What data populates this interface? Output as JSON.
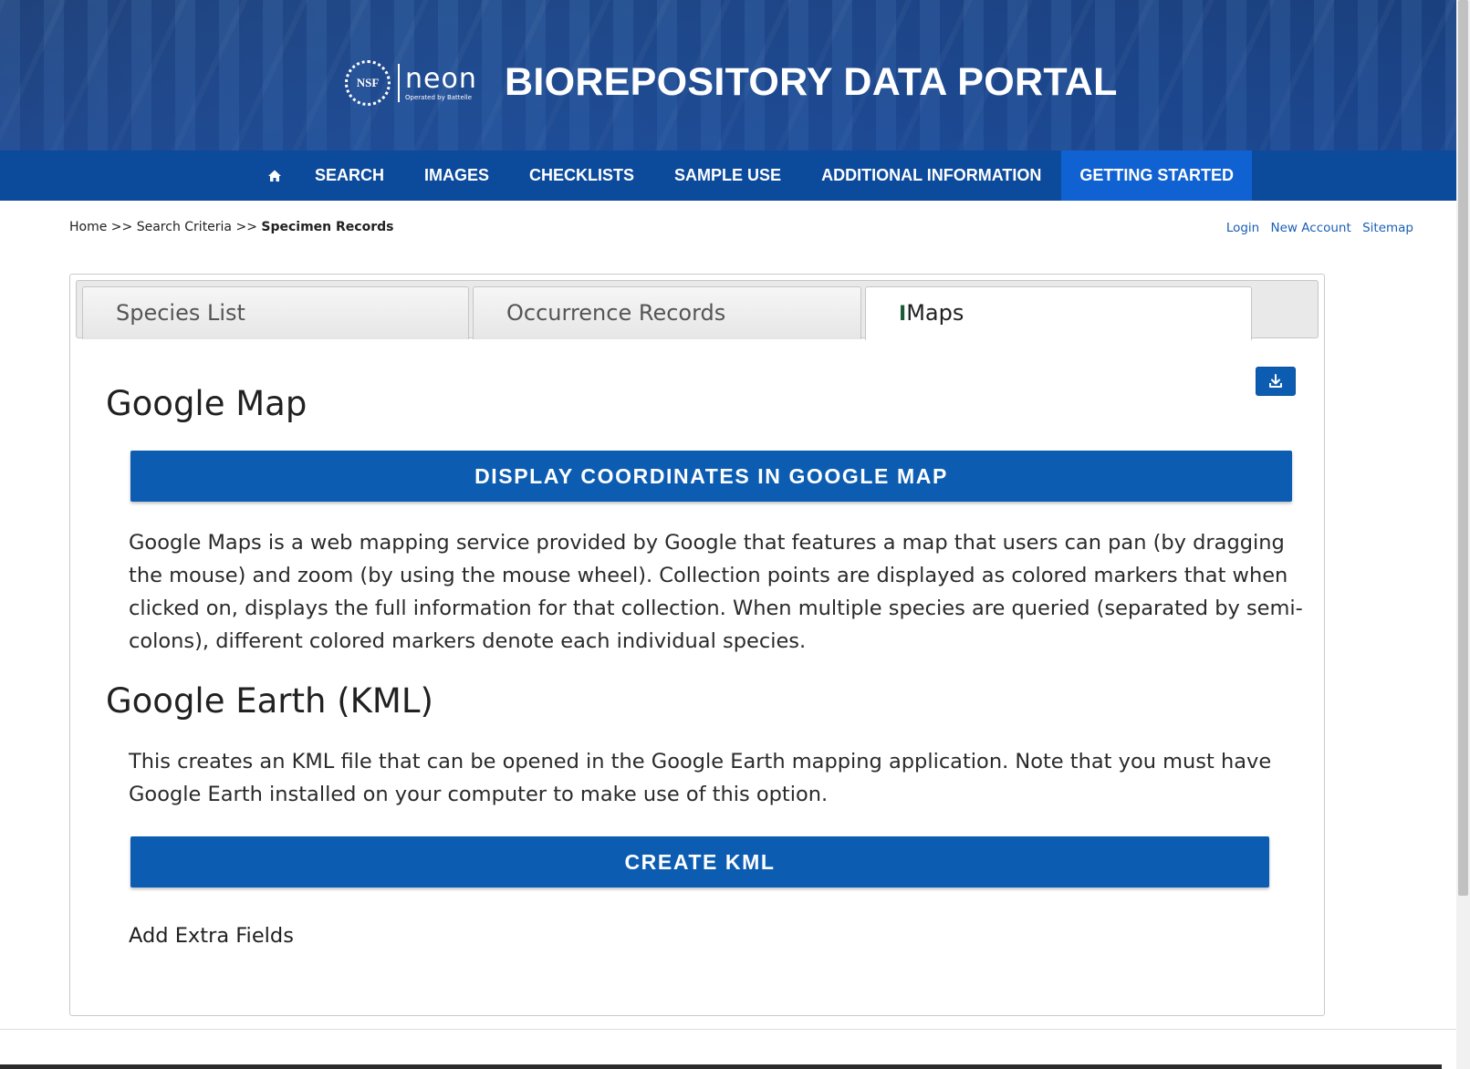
{
  "header": {
    "title": "BIOREPOSITORY DATA PORTAL",
    "nsf_logo_text": "NSF",
    "neon_logo_text": "neon",
    "neon_logo_sub": "Operated by Battelle"
  },
  "nav": {
    "home_icon": "home-icon",
    "items": [
      {
        "label": "SEARCH"
      },
      {
        "label": "IMAGES"
      },
      {
        "label": "CHECKLISTS"
      },
      {
        "label": "SAMPLE USE"
      },
      {
        "label": "ADDITIONAL INFORMATION"
      },
      {
        "label": "GETTING STARTED",
        "active": true
      }
    ],
    "colors": {
      "bar": "#0c4a9c",
      "active": "#1061d1"
    }
  },
  "breadcrumb": {
    "home": "Home",
    "sep": ">>",
    "criteria": "Search Criteria",
    "current": "Specimen Records"
  },
  "account": {
    "login": "Login",
    "new_account": "New Account",
    "sitemap": "Sitemap"
  },
  "tabs": [
    {
      "label": "Species List"
    },
    {
      "label": "Occurrence Records"
    },
    {
      "label": "Maps",
      "active": true
    }
  ],
  "content": {
    "download_icon": "download-icon",
    "google_map": {
      "heading": "Google Map",
      "button": "DISPLAY COORDINATES IN GOOGLE MAP",
      "description": "Google Maps is a web mapping service provided by Google that features a map that users can pan (by dragging the mouse) and zoom (by using the mouse wheel). Collection points are displayed as colored markers that when clicked on, displays the full information for that collection. When multiple species are queried (separated by semi-colons), different colored markers denote each individual species."
    },
    "google_earth": {
      "heading": "Google Earth (KML)",
      "description": "This creates an KML file that can be opened in the Google Earth mapping application. Note that you must have Google Earth installed on your computer to make use of this option.",
      "button": "CREATE KML"
    },
    "extra_fields": "Add Extra Fields",
    "accent": "#0c5db2"
  }
}
